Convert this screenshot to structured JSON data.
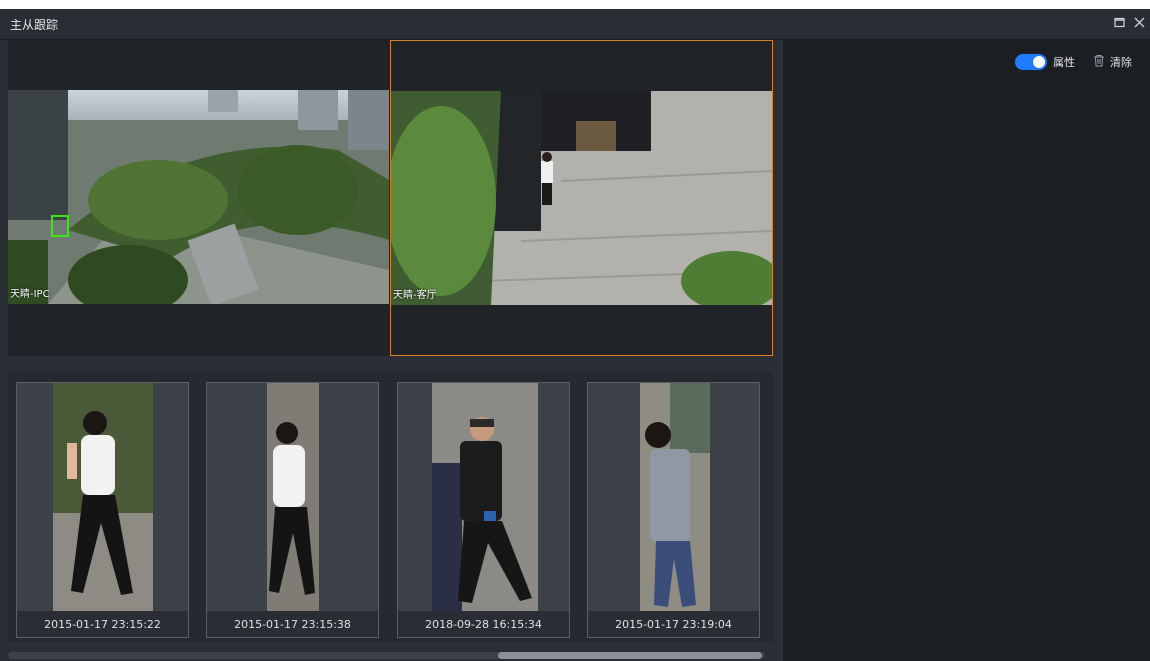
{
  "window": {
    "title": "主从跟踪"
  },
  "toolbar": {
    "toggle_label": "属性",
    "toggle_on": true,
    "clear_label": "清除",
    "accent": "#1f7bff"
  },
  "videos": [
    {
      "label": "天睛-IPC",
      "selected": false
    },
    {
      "label": "天睛-客厅",
      "selected": true
    }
  ],
  "thumbnails": [
    {
      "timestamp": "2015-01-17 23:15:22"
    },
    {
      "timestamp": "2015-01-17 23:15:38"
    },
    {
      "timestamp": "2018-09-28 16:15:34"
    },
    {
      "timestamp": "2015-01-17 23:19:04"
    }
  ],
  "colors": {
    "selected_border": "#d4802a",
    "detection_box": "#39e619"
  }
}
